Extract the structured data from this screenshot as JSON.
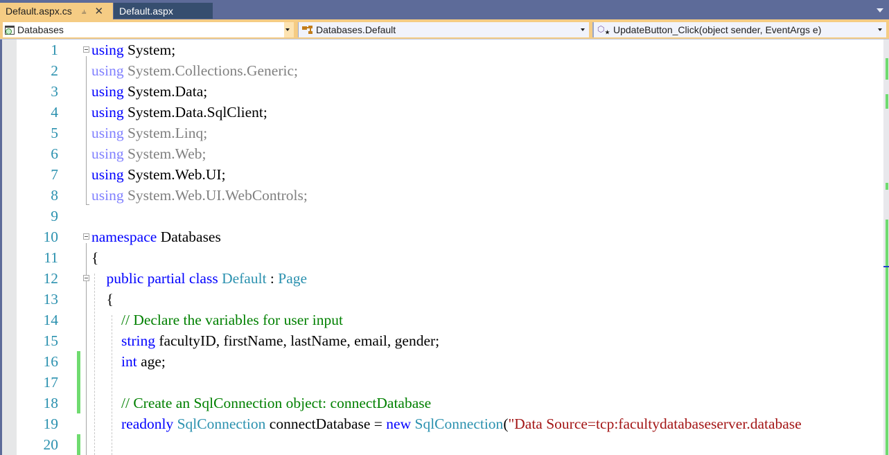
{
  "tabs": [
    {
      "label": "Default.aspx.cs",
      "active": true,
      "pinned": true
    },
    {
      "label": "Default.aspx",
      "active": false
    }
  ],
  "tab_icons": {
    "pin": "pin-icon",
    "close": "close-icon",
    "overflow": "tab-overflow-dropdown-icon"
  },
  "navbar": {
    "project": {
      "label": "Databases",
      "icon": "csharp-project-icon"
    },
    "type": {
      "label": "Databases.Default",
      "icon": "class-icon"
    },
    "member": {
      "label": "UpdateButton_Click(object sender, EventArgs e)",
      "icon": "method-icon"
    }
  },
  "colors": {
    "keyword": "#0000ff",
    "type": "#2b91af",
    "comment": "#008000",
    "string": "#a31515",
    "line_number": "#2b91af",
    "unused": "#808080",
    "active_tab": "#f5cc84",
    "change_marker": "#6fdb6f"
  },
  "editor": {
    "lines": [
      {
        "n": "1",
        "tokens": [
          {
            "t": "using",
            "c": "kw"
          },
          {
            "t": " System;",
            "c": ""
          }
        ]
      },
      {
        "n": "2",
        "tokens": [
          {
            "t": "using",
            "c": "kw-dim"
          },
          {
            "t": " System.Collections.Generic;",
            "c": "dim"
          }
        ]
      },
      {
        "n": "3",
        "tokens": [
          {
            "t": "using",
            "c": "kw"
          },
          {
            "t": " System.Data;",
            "c": ""
          }
        ]
      },
      {
        "n": "4",
        "tokens": [
          {
            "t": "using",
            "c": "kw"
          },
          {
            "t": " System.Data.SqlClient;",
            "c": ""
          }
        ]
      },
      {
        "n": "5",
        "tokens": [
          {
            "t": "using",
            "c": "kw-dim"
          },
          {
            "t": " System.Linq;",
            "c": "dim"
          }
        ]
      },
      {
        "n": "6",
        "tokens": [
          {
            "t": "using",
            "c": "kw-dim"
          },
          {
            "t": " System.Web;",
            "c": "dim"
          }
        ]
      },
      {
        "n": "7",
        "tokens": [
          {
            "t": "using",
            "c": "kw"
          },
          {
            "t": " System.Web.UI;",
            "c": ""
          }
        ]
      },
      {
        "n": "8",
        "tokens": [
          {
            "t": "using",
            "c": "kw-dim"
          },
          {
            "t": " System.Web.UI.WebControls;",
            "c": "dim"
          }
        ]
      },
      {
        "n": "9",
        "tokens": []
      },
      {
        "n": "10",
        "tokens": [
          {
            "t": "namespace",
            "c": "kw"
          },
          {
            "t": " Databases",
            "c": ""
          }
        ]
      },
      {
        "n": "11",
        "tokens": [
          {
            "t": "{",
            "c": ""
          }
        ]
      },
      {
        "n": "12",
        "tokens": [
          {
            "t": "    public partial class",
            "c": "kw"
          },
          {
            "t": " ",
            "c": ""
          },
          {
            "t": "Default",
            "c": "type"
          },
          {
            "t": " : ",
            "c": ""
          },
          {
            "t": "Page",
            "c": "type"
          }
        ]
      },
      {
        "n": "13",
        "tokens": [
          {
            "t": "    {",
            "c": ""
          }
        ]
      },
      {
        "n": "14",
        "tokens": [
          {
            "t": "        // Declare the variables for user input",
            "c": "cmt"
          }
        ]
      },
      {
        "n": "15",
        "tokens": [
          {
            "t": "        string",
            "c": "kw"
          },
          {
            "t": " facultyID, firstName, lastName, email, gender;",
            "c": ""
          }
        ]
      },
      {
        "n": "16",
        "tokens": [
          {
            "t": "        int",
            "c": "kw"
          },
          {
            "t": " age;",
            "c": ""
          }
        ]
      },
      {
        "n": "17",
        "tokens": []
      },
      {
        "n": "18",
        "tokens": [
          {
            "t": "        // Create an SqlConnection object: connectDatabase",
            "c": "cmt"
          }
        ]
      },
      {
        "n": "19",
        "tokens": [
          {
            "t": "        readonly",
            "c": "kw"
          },
          {
            "t": " ",
            "c": ""
          },
          {
            "t": "SqlConnection",
            "c": "type"
          },
          {
            "t": " connectDatabase = ",
            "c": ""
          },
          {
            "t": "new",
            "c": "kw"
          },
          {
            "t": " ",
            "c": ""
          },
          {
            "t": "SqlConnection",
            "c": "type"
          },
          {
            "t": "(",
            "c": ""
          },
          {
            "t": "\"Data Source=tcp:facultydatabaseserver.database",
            "c": "str"
          }
        ]
      },
      {
        "n": "20",
        "tokens": []
      }
    ],
    "changed_lines": [
      "16",
      "17",
      "18",
      "20"
    ]
  }
}
